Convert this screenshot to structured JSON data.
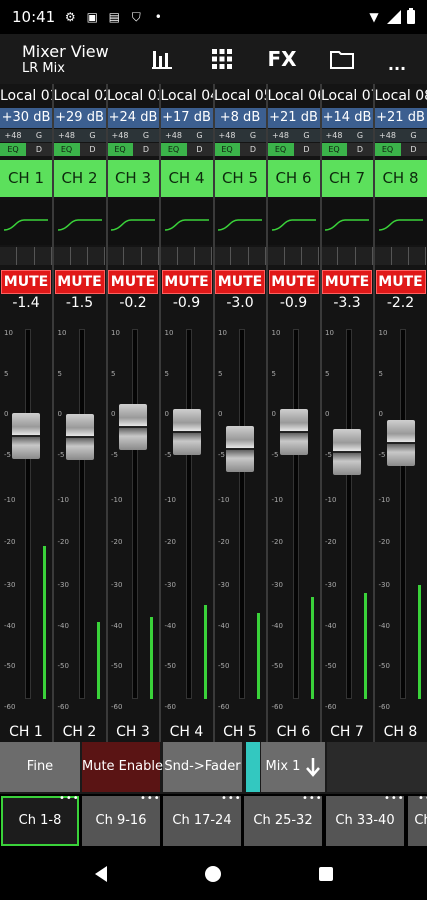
{
  "status": {
    "time": "10:41"
  },
  "header": {
    "title": "Mixer View",
    "subtitle": "LR Mix",
    "fx_label": "FX",
    "more_label": "..."
  },
  "channels": [
    {
      "name": "Local 01",
      "gain": "+30 dB",
      "fader": "-1.4",
      "label": "CH 1",
      "button": "CH 1",
      "mute": "MUTE",
      "fader_db": -1.4,
      "meter_db": -22
    },
    {
      "name": "Local 02",
      "gain": "+29 dB",
      "fader": "-1.5",
      "label": "CH 2",
      "button": "CH 2",
      "mute": "MUTE",
      "fader_db": -1.5,
      "meter_db": -40
    },
    {
      "name": "Local 03",
      "gain": "+24 dB",
      "fader": "-0.2",
      "label": "CH 3",
      "button": "CH 3",
      "mute": "MUTE",
      "fader_db": -0.2,
      "meter_db": -39
    },
    {
      "name": "Local 04",
      "gain": "+17 dB",
      "fader": "-0.9",
      "label": "CH 4",
      "button": "CH 4",
      "mute": "MUTE",
      "fader_db": -0.9,
      "meter_db": -36
    },
    {
      "name": "Local 05",
      "gain": "+8 dB",
      "fader": "-3.0",
      "label": "CH 5",
      "button": "CH 5",
      "mute": "MUTE",
      "fader_db": -3.0,
      "meter_db": -38
    },
    {
      "name": "Local 06",
      "gain": "+21 dB",
      "fader": "-0.9",
      "label": "CH 6",
      "button": "CH 6",
      "mute": "MUTE",
      "fader_db": -0.9,
      "meter_db": -34
    },
    {
      "name": "Local 07",
      "gain": "+14 dB",
      "fader": "-3.3",
      "label": "CH 7",
      "button": "CH 7",
      "mute": "MUTE",
      "fader_db": -3.3,
      "meter_db": -33
    },
    {
      "name": "Local 08",
      "gain": "+21 dB",
      "fader": "-2.2",
      "label": "CH 8",
      "button": "CH 8",
      "mute": "MUTE",
      "fader_db": -2.2,
      "meter_db": -31
    }
  ],
  "small_labels": {
    "phantom": "+48",
    "gate": "G",
    "eq": "EQ",
    "dyn": "D"
  },
  "scale_ticks": [
    "10",
    "5",
    "0",
    "-5",
    "-10",
    "-20",
    "-30",
    "-40",
    "-50",
    "-60"
  ],
  "controls": {
    "fine": "Fine",
    "mute_enable": "Mute Enable",
    "snd_fader": "Snd->Fader",
    "mix": "Mix 1"
  },
  "pages": [
    "Ch 1-8",
    "Ch 9-16",
    "Ch 17-24",
    "Ch 25-32",
    "Ch 33-40",
    "Ch"
  ],
  "colors": {
    "accent_green": "#5ce05c",
    "mute_red": "#e01818",
    "gain_blue": "#3c5f90",
    "teal": "#33c8c0"
  }
}
